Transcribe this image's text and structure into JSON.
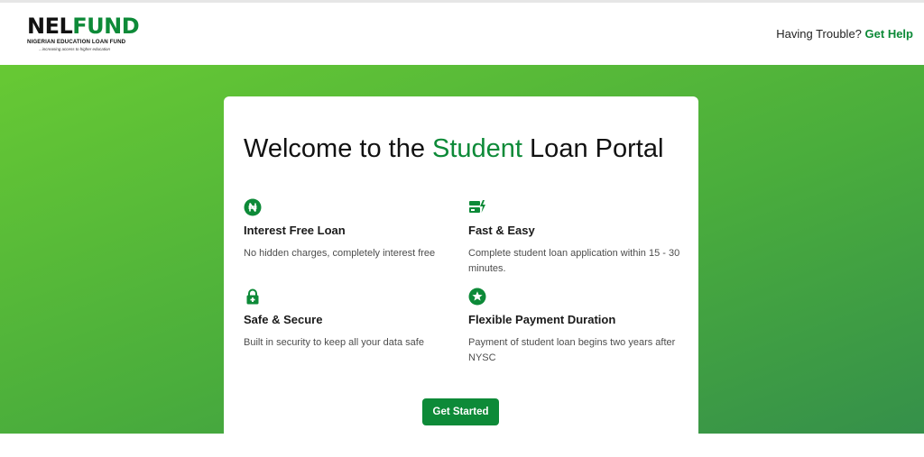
{
  "header": {
    "logo": {
      "name_part1": "NEL",
      "name_part2": "FUND",
      "subtitle": "NIGERIAN EDUCATION LOAN FUND",
      "tagline": "...increasing access to higher education"
    },
    "help_text": "Having Trouble?",
    "help_link": "Get Help"
  },
  "card": {
    "title_pre": "Welcome to the ",
    "title_accent": "Student",
    "title_post": " Loan Portal",
    "features": [
      {
        "icon": "naira-icon",
        "title": "Interest Free Loan",
        "description": "No hidden charges, completely interest free"
      },
      {
        "icon": "lightning-card-icon",
        "title": "Fast & Easy",
        "description": "Complete student loan application within 15 - 30 minutes."
      },
      {
        "icon": "lock-plus-icon",
        "title": "Safe & Secure",
        "description": "Built in security to keep all your data safe"
      },
      {
        "icon": "star-badge-icon",
        "title": "Flexible Payment Duration",
        "description": "Payment of student loan begins two years after NYSC"
      }
    ],
    "cta_label": "Get Started"
  },
  "colors": {
    "brand_green": "#0d8a38",
    "hero_gradient_start": "#67c934",
    "hero_gradient_end": "#35904a"
  }
}
